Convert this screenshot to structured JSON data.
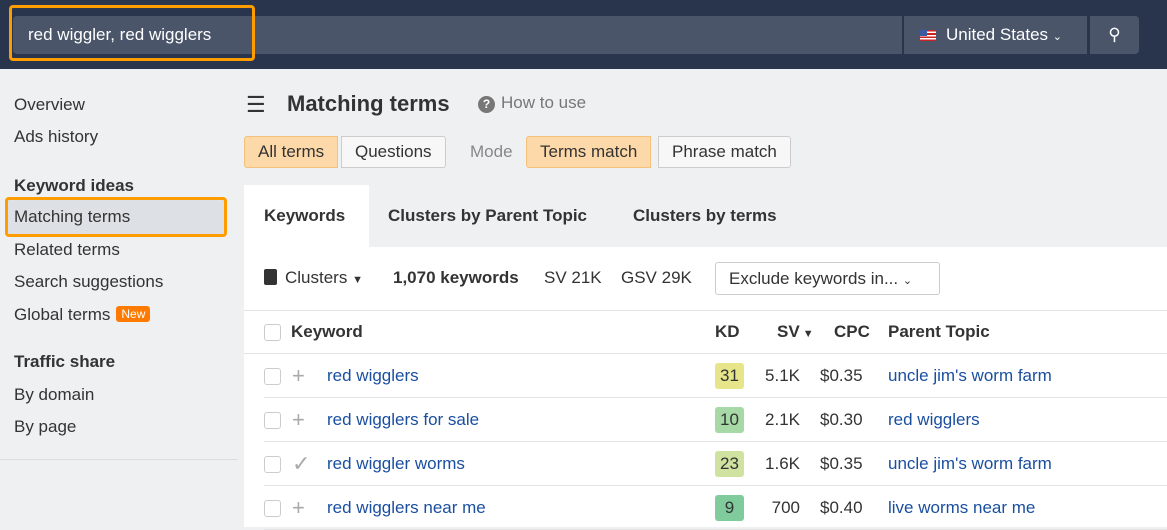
{
  "search": {
    "query": "red wiggler, red wigglers",
    "country": "United States"
  },
  "sidebar": {
    "items": [
      "Overview",
      "Ads history"
    ],
    "keyword_ideas": "Keyword ideas",
    "ki_items": [
      "Matching terms",
      "Related terms",
      "Search suggestions",
      "Global terms"
    ],
    "new_badge": "New",
    "traffic_share": "Traffic share",
    "ts_items": [
      "By domain",
      "By page"
    ]
  },
  "header": {
    "title": "Matching terms",
    "how_to": "How to use"
  },
  "filters": {
    "all_terms": "All terms",
    "questions": "Questions",
    "mode": "Mode",
    "terms_match": "Terms match",
    "phrase_match": "Phrase match"
  },
  "tabs": [
    "Keywords",
    "Clusters by Parent Topic",
    "Clusters by terms"
  ],
  "summary": {
    "clusters": "Clusters",
    "count": "1,070 keywords",
    "sv": "SV 21K",
    "gsv": "GSV 29K",
    "exclude": "Exclude keywords in..."
  },
  "columns": {
    "keyword": "Keyword",
    "kd": "KD",
    "sv": "SV",
    "cpc": "CPC",
    "parent": "Parent Topic"
  },
  "rows": [
    {
      "keyword": "red wigglers",
      "kd": "31",
      "kd_color": "#e6e58a",
      "sv": "5.1K",
      "cpc": "$0.35",
      "parent": "uncle jim's worm farm",
      "icon": "+"
    },
    {
      "keyword": "red wigglers for sale",
      "kd": "10",
      "kd_color": "#a6d9a6",
      "sv": "2.1K",
      "cpc": "$0.30",
      "parent": "red wigglers",
      "icon": "+"
    },
    {
      "keyword": "red wiggler worms",
      "kd": "23",
      "kd_color": "#cfe2a0",
      "sv": "1.6K",
      "cpc": "$0.35",
      "parent": "uncle jim's worm farm",
      "icon": "✓"
    },
    {
      "keyword": "red wigglers near me",
      "kd": "9",
      "kd_color": "#7fcb9b",
      "sv": "700",
      "cpc": "$0.40",
      "parent": "live worms near me",
      "icon": "+"
    }
  ]
}
